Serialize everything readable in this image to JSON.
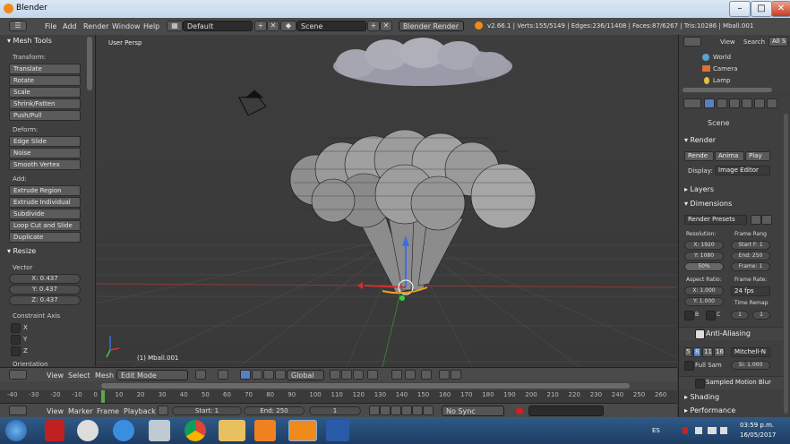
{
  "window": {
    "title": "Blender",
    "min": "–",
    "max": "□",
    "close": "✕"
  },
  "info": {
    "menus": [
      "File",
      "Add",
      "Render",
      "Window",
      "Help"
    ],
    "layout": "Default",
    "scene": "Scene",
    "engine": "Blender Render",
    "stats": "v2.66.1 | Verts:155/5149 | Edges:236/11408 | Faces:87/6267 | Tris:10286 | Mball.001"
  },
  "tools": {
    "header": "▾ Mesh Tools",
    "transform_label": "Transform:",
    "transform": [
      "Translate",
      "Rotate",
      "Scale",
      "Shrink/Fatten",
      "Push/Pull"
    ],
    "deform_label": "Deform:",
    "deform": [
      "Edge Slide",
      "Noise",
      "Smooth Vertex"
    ],
    "add_label": "Add:",
    "add": [
      "Extrude Region",
      "Extrude Individual",
      "Subdivide",
      "Loop Cut and Slide",
      "Duplicate"
    ],
    "resize_header": "▾ Resize",
    "vector_label": "Vector",
    "vector": [
      "X: 0.437",
      "Y: 0.437",
      "Z: 0.437"
    ],
    "constraint_label": "Constraint Axis",
    "axes": [
      "X",
      "Y",
      "Z"
    ],
    "orientation_label": "Orientation"
  },
  "viewport": {
    "view_name": "User Persp",
    "object_label": "(1) Mball.001"
  },
  "view_header": {
    "menus": [
      "View",
      "Select",
      "Mesh"
    ],
    "mode": "Edit Mode",
    "orientation": "Global"
  },
  "timeline": {
    "ticks": [
      "-40",
      "-30",
      "-20",
      "-10",
      "0",
      "10",
      "20",
      "30",
      "40",
      "50",
      "60",
      "70",
      "80",
      "90",
      "100",
      "110",
      "120",
      "130",
      "140",
      "150",
      "160",
      "170",
      "180",
      "190",
      "200",
      "210",
      "220",
      "230",
      "240",
      "250",
      "260"
    ],
    "menus": [
      "View",
      "Marker",
      "Frame",
      "Playback"
    ],
    "start": "Start: 1",
    "end": "End: 250",
    "current": "1",
    "sync": "No Sync"
  },
  "outliner": {
    "menus": [
      "View",
      "Search",
      "All S"
    ],
    "items": [
      "World",
      "Camera",
      "Lamp"
    ]
  },
  "properties": {
    "scene_label": "Scene",
    "render_header": "▾ Render",
    "render_buttons": [
      "Rende",
      "Anima",
      "Play"
    ],
    "display_label": "Display:",
    "display_value": "Image Editor",
    "layers_header": "▸ Layers",
    "dimensions_header": "▾ Dimensions",
    "presets": "Render Presets",
    "resolution_label": "Resolution:",
    "frame_range_label": "Frame Rang",
    "res_x": "X: 1920",
    "res_y": "Y: 1080",
    "res_pct": "50%",
    "start_frame": "Start F: 1",
    "end_frame": "End: 250",
    "frame_step": "Frame: 1",
    "aspect_label": "Aspect Ratio:",
    "frame_rate_label": "Frame Rate:",
    "asp_x": "X: 1.000",
    "asp_y": "Y: 1.000",
    "fps": "24 fps",
    "time_remap": "Time Remap",
    "border_b": "B",
    "border_c": "C",
    "remap_old": "1",
    "remap_new": "1",
    "aa_header": "Anti-Aliasing",
    "aa_samples": [
      "5",
      "8",
      "11",
      "16"
    ],
    "aa_filter": "Mitchell-N",
    "full_sample": "Full Sam",
    "aa_size": "Si: 1.000",
    "motion_blur": "Sampled Motion Blur",
    "shading": "▸ Shading",
    "performance": "▸ Performance"
  },
  "taskbar": {
    "lang": "ES",
    "time": "03:59 p.m.",
    "date": "16/05/2017"
  },
  "colors": {
    "accent": "#5680c2",
    "blender_orange": "#f08a1a"
  }
}
